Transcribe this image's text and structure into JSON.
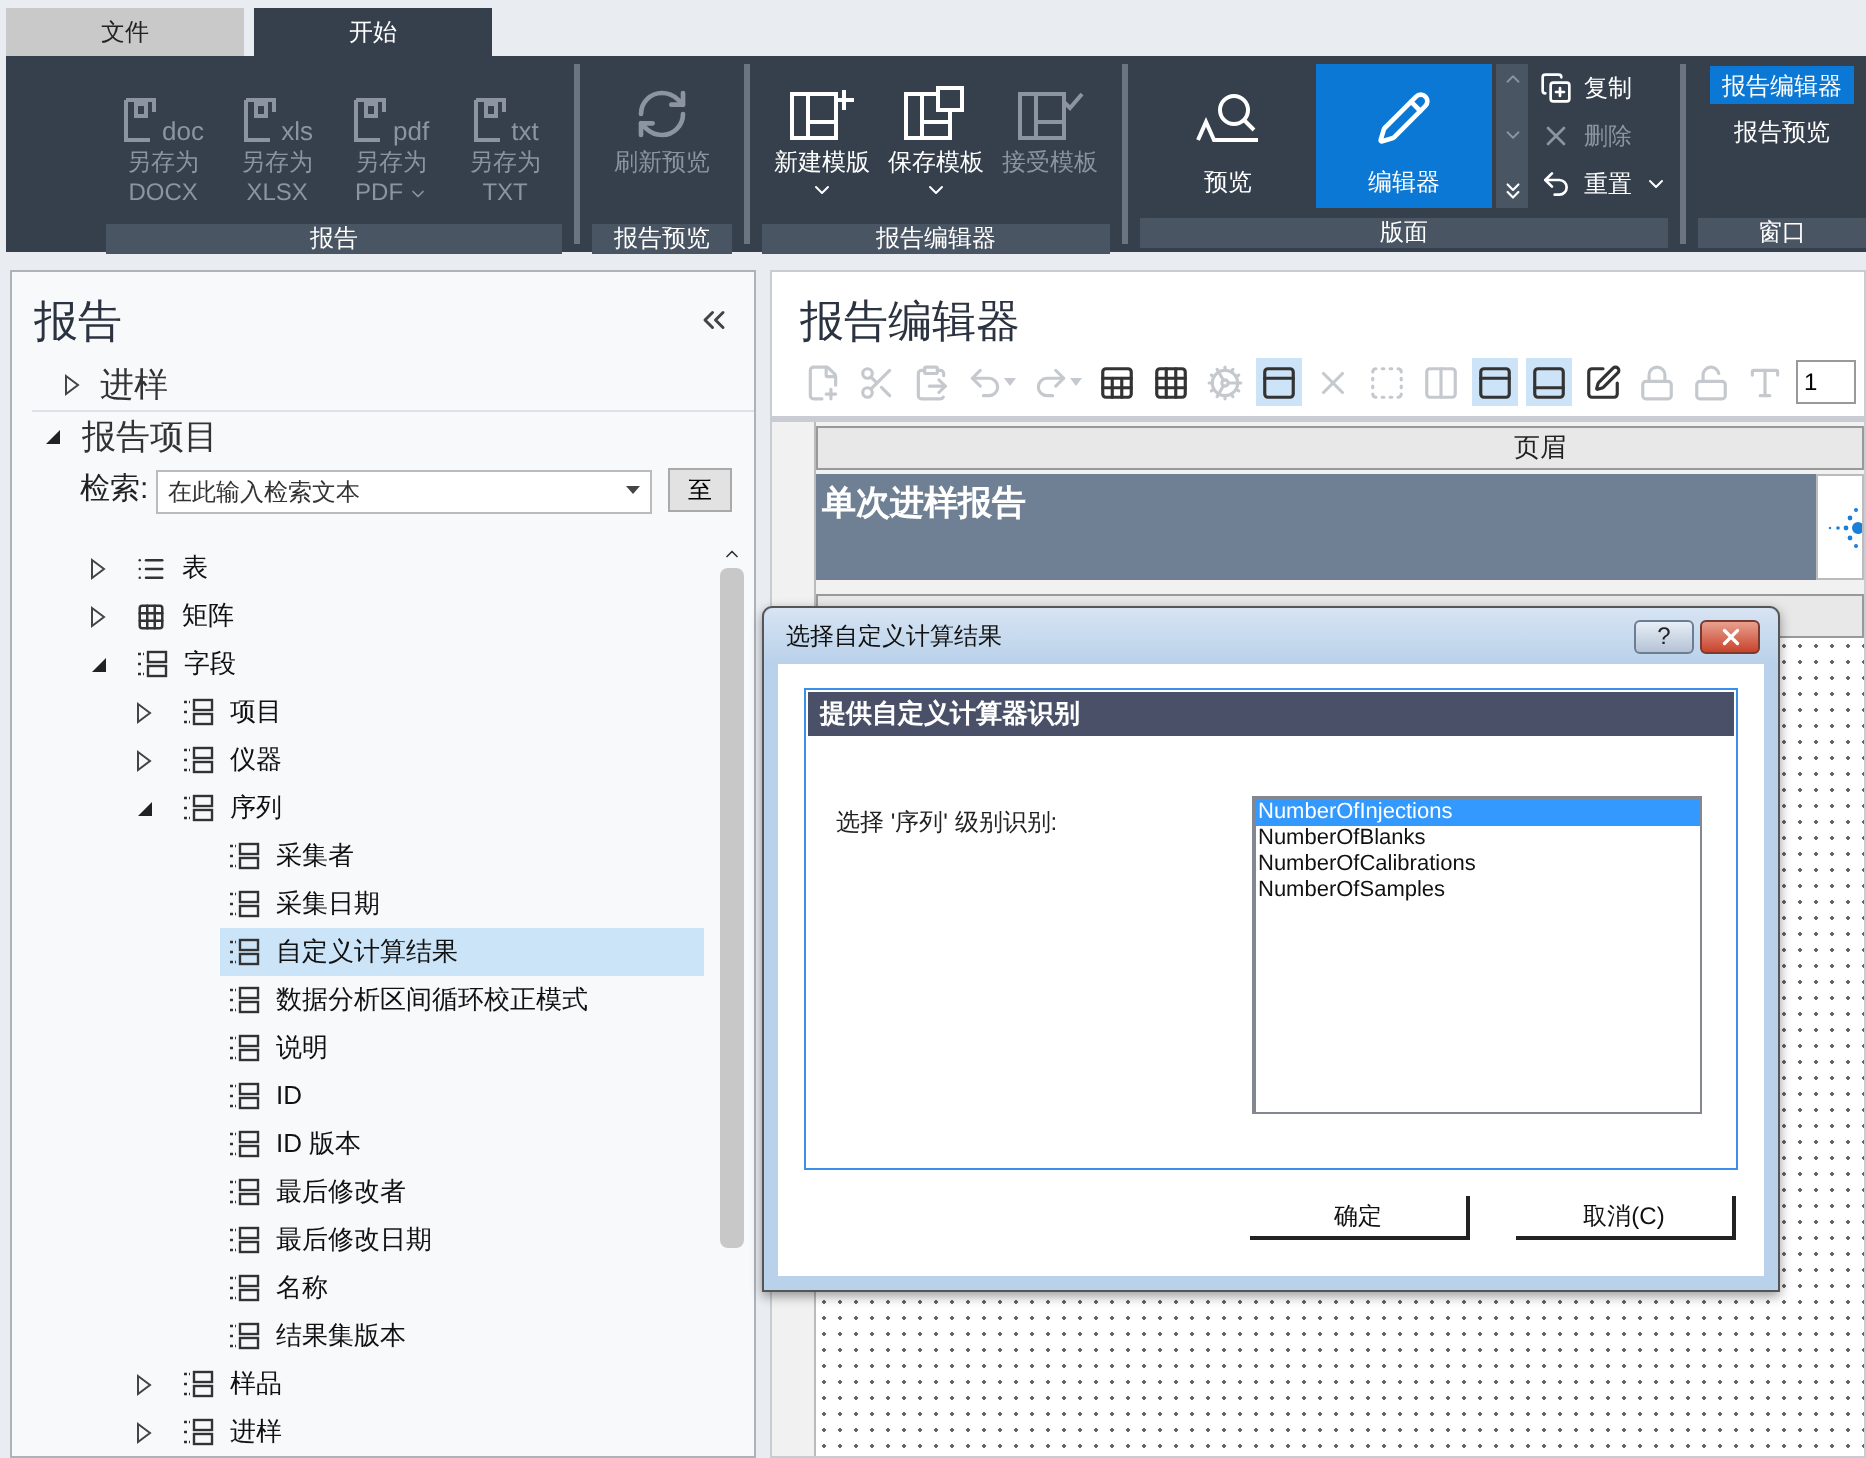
{
  "tabs": [
    {
      "label": "文件",
      "selected": false
    },
    {
      "label": "开始",
      "selected": true
    }
  ],
  "ribbon": {
    "groups": [
      {
        "label": "报告",
        "large": [
          {
            "label": "另存为",
            "sublabel": "DOCX",
            "badge": "doc",
            "disabled": true,
            "dropdown": false
          },
          {
            "label": "另存为",
            "sublabel": "XLSX",
            "badge": "xls",
            "disabled": true,
            "dropdown": false
          },
          {
            "label": "另存为",
            "sublabel": "PDF",
            "badge": "pdf",
            "disabled": true,
            "dropdown": true
          },
          {
            "label": "另存为",
            "sublabel": "TXT",
            "badge": "txt",
            "disabled": true,
            "dropdown": false
          }
        ]
      },
      {
        "label": "报告预览",
        "large": [
          {
            "label": "刷新预览",
            "disabled": true,
            "dropdown": false
          }
        ]
      },
      {
        "label": "报告编辑器",
        "large": [
          {
            "label": "新建模版",
            "disabled": false,
            "dropdown": true
          },
          {
            "label": "保存模板",
            "disabled": false,
            "dropdown": true
          },
          {
            "label": "接受模板",
            "disabled": true,
            "dropdown": false
          }
        ]
      },
      {
        "label": "版面",
        "large": [
          {
            "label": "预览",
            "disabled": false,
            "dropdown": false,
            "selected": false
          },
          {
            "label": "编辑器",
            "disabled": false,
            "dropdown": false,
            "selected": true
          }
        ],
        "small": [
          {
            "label": "复制",
            "disabled": false,
            "dropdown": false
          },
          {
            "label": "删除",
            "disabled": true,
            "dropdown": false
          },
          {
            "label": "重置",
            "disabled": false,
            "dropdown": true
          }
        ]
      },
      {
        "label": "窗口",
        "toggles": [
          {
            "label": "报告编辑器",
            "selected": true
          },
          {
            "label": "报告预览",
            "selected": false
          }
        ]
      }
    ]
  },
  "left_panel": {
    "title": "报告",
    "sections": [
      {
        "label": "进样",
        "expanded": false
      },
      {
        "label": "报告项目",
        "expanded": true
      }
    ],
    "search": {
      "label": "检索:",
      "placeholder": "在此输入检索文本",
      "button": "至"
    },
    "tree": [
      {
        "label": "表",
        "kind": "table",
        "expanded": false,
        "selected": false
      },
      {
        "label": "矩阵",
        "kind": "matrix",
        "expanded": false,
        "selected": false
      },
      {
        "label": "字段",
        "kind": "field",
        "expanded": true,
        "selected": false,
        "children": [
          {
            "label": "项目",
            "kind": "field",
            "expanded": false,
            "selected": false
          },
          {
            "label": "仪器",
            "kind": "field",
            "expanded": false,
            "selected": false
          },
          {
            "label": "序列",
            "kind": "field",
            "expanded": true,
            "selected": false,
            "children": [
              {
                "label": "采集者",
                "kind": "field",
                "selected": false
              },
              {
                "label": "采集日期",
                "kind": "field",
                "selected": false
              },
              {
                "label": "自定义计算结果",
                "kind": "field",
                "selected": true
              },
              {
                "label": "数据分析区间循环校正模式",
                "kind": "field",
                "selected": false
              },
              {
                "label": "说明",
                "kind": "field",
                "selected": false
              },
              {
                "label": "ID",
                "kind": "field",
                "selected": false
              },
              {
                "label": "ID 版本",
                "kind": "field",
                "selected": false
              },
              {
                "label": "最后修改者",
                "kind": "field",
                "selected": false
              },
              {
                "label": "最后修改日期",
                "kind": "field",
                "selected": false
              },
              {
                "label": "名称",
                "kind": "field",
                "selected": false
              },
              {
                "label": "结果集版本",
                "kind": "field",
                "selected": false
              }
            ]
          },
          {
            "label": "样品",
            "kind": "field",
            "expanded": false,
            "selected": false
          },
          {
            "label": "进样",
            "kind": "field",
            "expanded": false,
            "selected": false
          }
        ]
      }
    ]
  },
  "editor": {
    "title": "报告编辑器",
    "toolbar": [
      {
        "disabled": true,
        "selected": false
      },
      {
        "disabled": true,
        "selected": false
      },
      {
        "disabled": true,
        "selected": false
      },
      {
        "disabled": true,
        "selected": false
      },
      {
        "disabled": true,
        "selected": false
      },
      {
        "disabled": false,
        "selected": false
      },
      {
        "disabled": false,
        "selected": false
      },
      {
        "disabled": true,
        "selected": false
      },
      {
        "disabled": false,
        "selected": true
      },
      {
        "disabled": true,
        "selected": false
      },
      {
        "disabled": true,
        "selected": false
      },
      {
        "disabled": true,
        "selected": false
      },
      {
        "disabled": false,
        "selected": true
      },
      {
        "disabled": false,
        "selected": true
      },
      {
        "disabled": false,
        "selected": false
      },
      {
        "disabled": true,
        "selected": false
      },
      {
        "disabled": true,
        "selected": false
      },
      {
        "disabled": true,
        "selected": false
      }
    ],
    "toolbar_field": "1",
    "page_header": "页眉",
    "report_title": "单次进样报告"
  },
  "dialog": {
    "title": "选择自定义计算结果",
    "help": "?",
    "group_title": "提供自定义计算器识别",
    "prompt": "选择 '序列' 级别识别:",
    "options": [
      {
        "label": "NumberOfInjections",
        "selected": true
      },
      {
        "label": "NumberOfBlanks",
        "selected": false
      },
      {
        "label": "NumberOfCalibrations",
        "selected": false
      },
      {
        "label": "NumberOfSamples",
        "selected": false
      }
    ],
    "buttons": [
      "确定",
      "取消(C)"
    ]
  }
}
